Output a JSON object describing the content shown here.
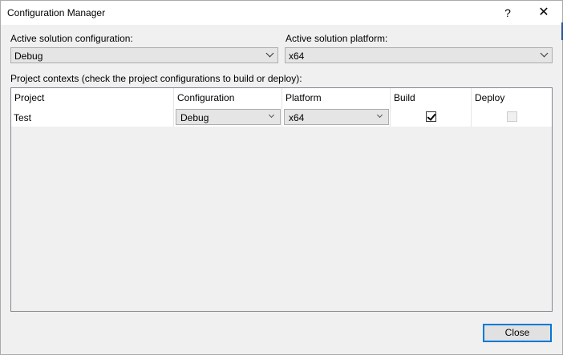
{
  "window": {
    "title": "Configuration Manager",
    "help_glyph": "?",
    "close_glyph": "✕"
  },
  "solution": {
    "config_label": "Active solution configuration:",
    "config_value": "Debug",
    "platform_label": "Active solution platform:",
    "platform_value": "x64"
  },
  "contexts": {
    "label": "Project contexts (check the project configurations to build or deploy):",
    "columns": [
      "Project",
      "Configuration",
      "Platform",
      "Build",
      "Deploy"
    ],
    "rows": [
      {
        "project": "Test",
        "configuration": "Debug",
        "platform": "x64",
        "build": true,
        "deploy": false,
        "deploy_enabled": false
      }
    ]
  },
  "buttons": {
    "close_label": "Close"
  },
  "colors": {
    "accent": "#0078d7",
    "dialog_bg": "#f0f0f0"
  }
}
